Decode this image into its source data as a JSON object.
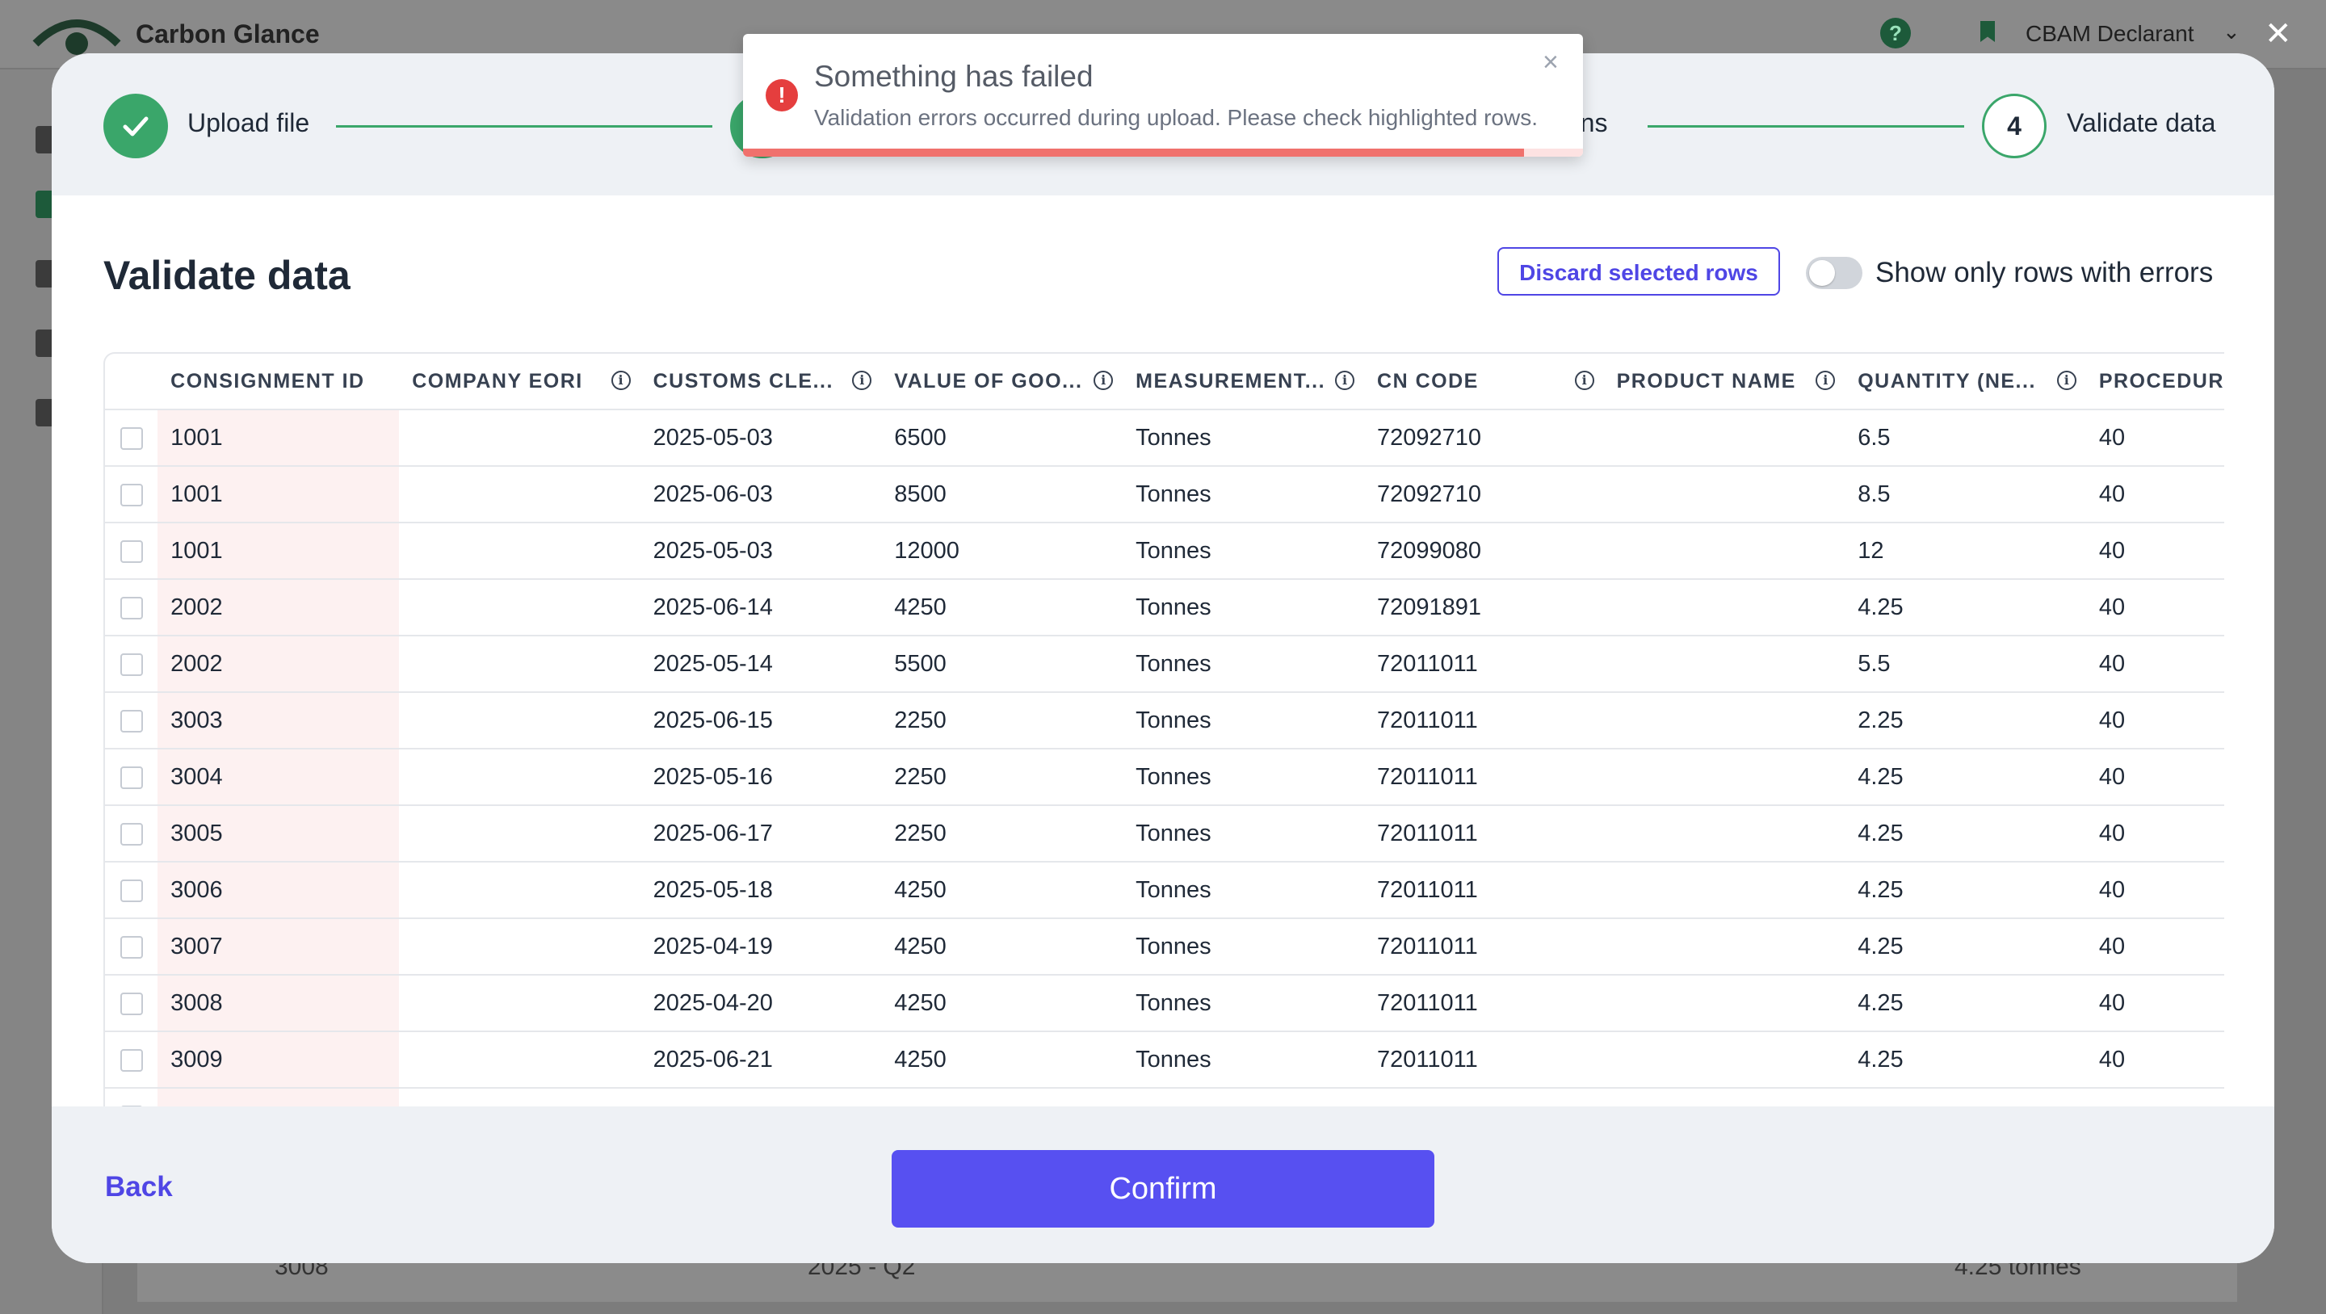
{
  "app": {
    "name": "Carbon Glance",
    "help_glyph": "?",
    "role": "CBAM Declarant",
    "background_row": {
      "id": "3008",
      "period": "2025 - Q2",
      "value": "4.25 tonnes"
    }
  },
  "modal": {
    "close_glyph": "✕",
    "steps": [
      {
        "label": "Upload file",
        "state": "done"
      },
      {
        "label": "",
        "state": "done"
      },
      {
        "label": "Map columns",
        "visible_fragment": "mns",
        "state": "done"
      },
      {
        "number": "4",
        "label": "Validate data",
        "state": "current"
      }
    ],
    "title": "Validate data",
    "discard_button": "Discard selected rows",
    "toggle_label": "Show only rows with errors",
    "toggle_on": false,
    "columns": [
      {
        "label": "CONSIGNMENT ID",
        "info": false
      },
      {
        "label": "COMPANY EORI",
        "info": true
      },
      {
        "label": "CUSTOMS CLE...",
        "info": true
      },
      {
        "label": "VALUE OF GOO...",
        "info": true
      },
      {
        "label": "MEASUREMENT...",
        "info": true
      },
      {
        "label": "CN CODE",
        "info": true
      },
      {
        "label": "PRODUCT NAME",
        "info": true
      },
      {
        "label": "QUANTITY (NE...",
        "info": true
      },
      {
        "label": "PROCEDUR",
        "info": false
      }
    ],
    "rows": [
      [
        "1001",
        "",
        "2025-05-03",
        "6500",
        "Tonnes",
        "72092710",
        "",
        "6.5",
        "40"
      ],
      [
        "1001",
        "",
        "2025-06-03",
        "8500",
        "Tonnes",
        "72092710",
        "",
        "8.5",
        "40"
      ],
      [
        "1001",
        "",
        "2025-05-03",
        "12000",
        "Tonnes",
        "72099080",
        "",
        "12",
        "40"
      ],
      [
        "2002",
        "",
        "2025-06-14",
        "4250",
        "Tonnes",
        "72091891",
        "",
        "4.25",
        "40"
      ],
      [
        "2002",
        "",
        "2025-05-14",
        "5500",
        "Tonnes",
        "72011011",
        "",
        "5.5",
        "40"
      ],
      [
        "3003",
        "",
        "2025-06-15",
        "2250",
        "Tonnes",
        "72011011",
        "",
        "2.25",
        "40"
      ],
      [
        "3004",
        "",
        "2025-05-16",
        "2250",
        "Tonnes",
        "72011011",
        "",
        "4.25",
        "40"
      ],
      [
        "3005",
        "",
        "2025-06-17",
        "2250",
        "Tonnes",
        "72011011",
        "",
        "4.25",
        "40"
      ],
      [
        "3006",
        "",
        "2025-05-18",
        "4250",
        "Tonnes",
        "72011011",
        "",
        "4.25",
        "40"
      ],
      [
        "3007",
        "",
        "2025-04-19",
        "4250",
        "Tonnes",
        "72011011",
        "",
        "4.25",
        "40"
      ],
      [
        "3008",
        "",
        "2025-04-20",
        "4250",
        "Tonnes",
        "72011011",
        "",
        "4.25",
        "40"
      ],
      [
        "3009",
        "",
        "2025-06-21",
        "4250",
        "Tonnes",
        "72011011",
        "",
        "4.25",
        "40"
      ],
      [
        "",
        "",
        "",
        "",
        "",
        "",
        "",
        "",
        ""
      ]
    ],
    "back_button": "Back",
    "confirm_button": "Confirm"
  },
  "toast": {
    "icon": "!",
    "title": "Something has failed",
    "message": "Validation errors occurred during upload. Please check highlighted rows.",
    "close_glyph": "×",
    "progress": 0.93
  },
  "colors": {
    "accent": "#5750f1",
    "success": "#3aa66a",
    "error": "#e53e3e",
    "error_cell": "#fdf1f1",
    "brand_dark": "#1d5a3a"
  }
}
